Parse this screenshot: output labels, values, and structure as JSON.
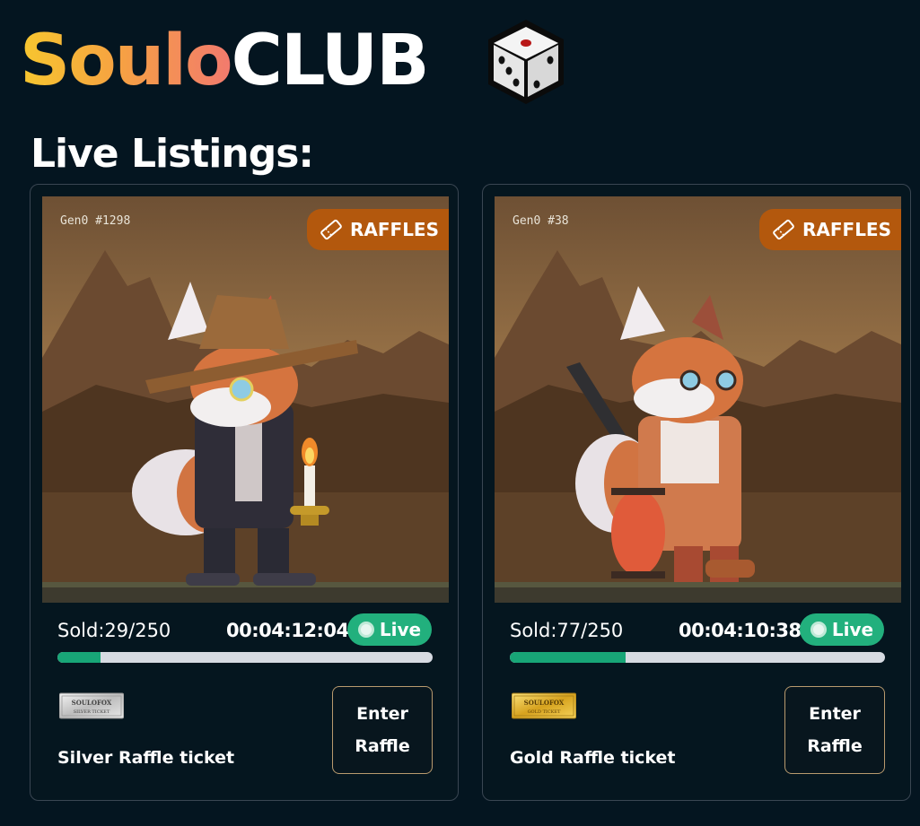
{
  "brand": {
    "name_part1": "Soulo",
    "name_part2": "CLUB",
    "gradient_colors": [
      "#f7c72f",
      "#f6a341",
      "#f27a6e"
    ]
  },
  "section": {
    "title": "Live Listings:"
  },
  "listings": [
    {
      "gen_label": "Gen0 #1298",
      "badge": "RAFFLES",
      "sold_label": "Sold:29/250",
      "sold": 29,
      "total": 250,
      "timer": "00:04:12:04",
      "status": "Live",
      "ticket_brand": "SOULOFOX",
      "ticket_type": "SILVER TICKET",
      "ticket_name": "Silver Raffle ticket",
      "button_label": "Enter Raffle"
    },
    {
      "gen_label": "Gen0 #38",
      "badge": "RAFFLES",
      "sold_label": "Sold:77/250",
      "sold": 77,
      "total": 250,
      "timer": "00:04:10:38",
      "status": "Live",
      "ticket_brand": "SOULOFOX",
      "ticket_type": "GOLD TICKET",
      "ticket_name": "Gold Raffle ticket",
      "button_label": "Enter Raffle"
    }
  ],
  "colors": {
    "background": "#041520",
    "badge": "#b3580d",
    "live": "#22b07d",
    "progress": "#18a677",
    "progress_track": "#d7dbe2"
  },
  "icons": [
    "dice-icon",
    "ticket-icon",
    "live-dot-icon"
  ]
}
